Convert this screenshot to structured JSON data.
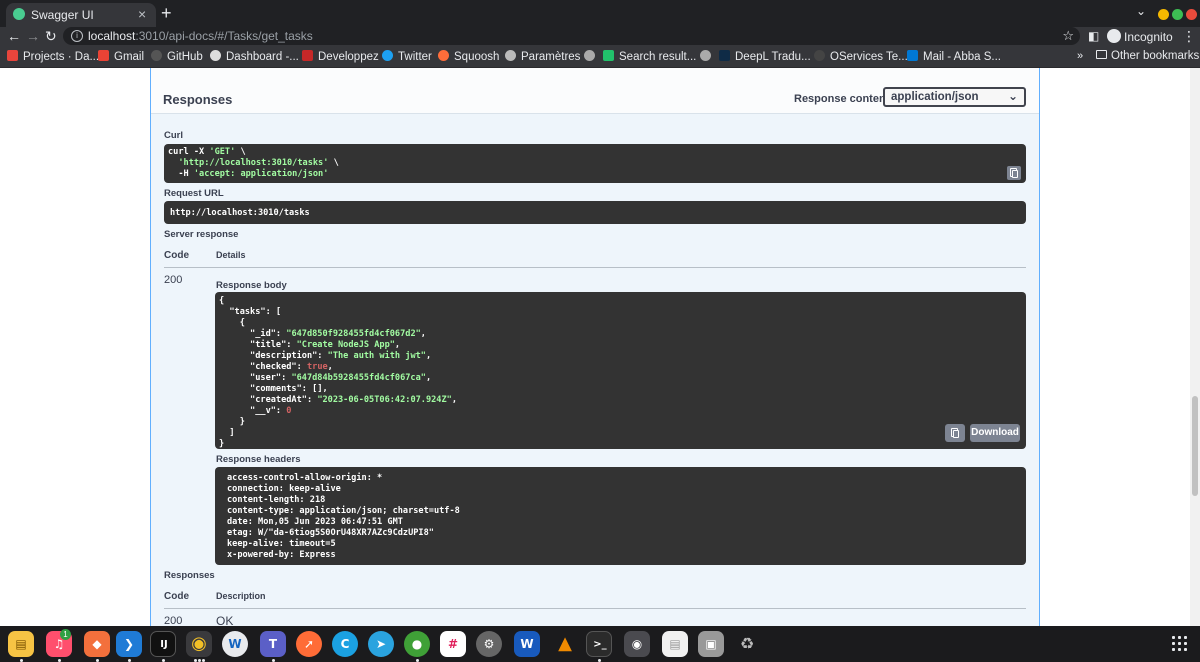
{
  "browser": {
    "tab_title": "Swagger UI",
    "tab_close": "×",
    "new_tab": "+",
    "url_host": "localhost",
    "url_rest": ":3010/api-docs/#/Tasks/get_tasks",
    "profile_label": "Incognito",
    "bookmarks": [
      "Projects · Da...",
      "Gmail",
      "GitHub",
      "Dashboard -...",
      "Developpez",
      "Twitter",
      "Squoosh",
      "Paramètres",
      "Search result...",
      "",
      "DeepL Tradu...",
      "OServices Te...",
      "Mail - Abba S..."
    ],
    "other_bookmarks": "Other bookmarks",
    "more": "»"
  },
  "swagger": {
    "responses_title": "Responses",
    "content_type_label": "Response content type",
    "content_type_value": "application/json",
    "curl_label": "Curl",
    "curl_lines": [
      "curl -X 'GET' \\",
      "  'http://localhost:3010/tasks' \\",
      "  -H 'accept: application/json'"
    ],
    "request_url_label": "Request URL",
    "request_url": "http://localhost:3010/tasks",
    "server_response_label": "Server response",
    "col_code": "Code",
    "col_details": "Details",
    "status_code": "200",
    "response_body_label": "Response body",
    "body": {
      "id": "\"647d850f928455fd4cf067d2\"",
      "title": "\"Create NodeJS App\"",
      "description": "\"The auth with jwt\"",
      "checked": "true",
      "user": "\"647d84b5928455fd4cf067ca\"",
      "comments": "[]",
      "createdAt": "\"2023-06-05T06:42:07.924Z\"",
      "v": "0"
    },
    "download_label": "Download",
    "response_headers_label": "Response headers",
    "headers": [
      "access-control-allow-origin: *",
      "connection: keep-alive",
      "content-length: 218",
      "content-type: application/json; charset=utf-8",
      "date: Mon,05 Jun 2023 06:47:51 GMT",
      "etag: W/\"da-6tiog5S0OrU48XR7AZc9CdzUPI8\"",
      "keep-alive: timeout=5",
      "x-powered-by: Express"
    ],
    "responses2_label": "Responses",
    "col_description": "Description",
    "doc_code": "200",
    "doc_description": "OK"
  },
  "dock": {
    "badge": "1",
    "apps": [
      "files-app",
      "music-app",
      "git-app",
      "vscode-app",
      "intellij-app",
      "chrome-app",
      "writer-app",
      "teams-app",
      "postman-app",
      "browser-app",
      "telegram-app",
      "mongodb-app",
      "slack-app",
      "settings-app",
      "word-app",
      "vlc-app",
      "terminal-app",
      "screenshot-app",
      "document-viewer-app",
      "drive-app",
      "trash-app"
    ]
  },
  "colors": {
    "accent": "#61affe",
    "code_bg": "#333333",
    "string": "#a2fca2",
    "number": "#d36363"
  }
}
